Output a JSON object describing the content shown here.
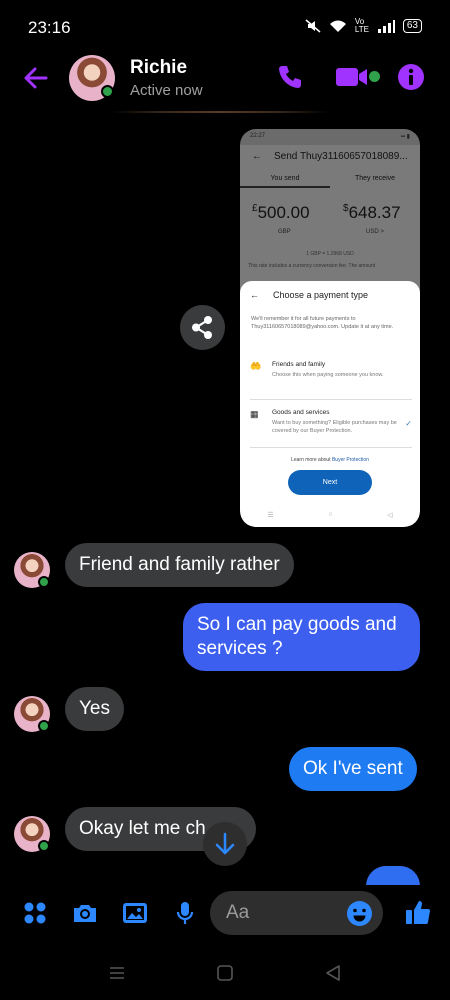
{
  "status": {
    "time": "23:16",
    "network": "Vo LTE",
    "battery": "63",
    "icons": [
      "mute-icon",
      "wifi-icon",
      "volte-icon",
      "signal-icon",
      "battery-icon"
    ]
  },
  "header": {
    "contact_name": "Richie",
    "presence": "Active now",
    "accent": "#a033ff",
    "icons": [
      "back-arrow-icon",
      "phone-icon",
      "video-camera-icon",
      "info-icon"
    ]
  },
  "shared_image": {
    "status_time": "22:27",
    "title": "Send Thuy31160657018089...",
    "tab_send": "You send",
    "tab_receive": "They receive",
    "send_amount": "500.00",
    "send_symbol": "£",
    "send_currency": "GBP",
    "receive_amount": "648.37",
    "receive_symbol": "$",
    "receive_currency": "USD >",
    "rate": "1 GBP = 1.2968 USD",
    "note": "This rate includes a currency conversion fee. The amount",
    "sheet_title": "Choose a payment type",
    "sheet_text": "We'll remember it for all future payments to Thuy31160657018089@yahoo.com. Update it at any time.",
    "option1_title": "Friends and family",
    "option1_desc": "Choose this when paying someone you know.",
    "option2_title": "Goods and services",
    "option2_desc": "Want to buy something? Eligible purchases may be covered by our Buyer Protection.",
    "learn_more": "Learn more about",
    "learn_link": "Buyer Protection",
    "next_button": "Next"
  },
  "messages": [
    {
      "from": "them",
      "text": "Friend and family rather"
    },
    {
      "from": "me",
      "text": "So I can pay goods and services ?"
    },
    {
      "from": "them",
      "text": "Yes"
    },
    {
      "from": "me",
      "text": "Ok I've sent"
    },
    {
      "from": "them",
      "text": "Okay let me ch..."
    }
  ],
  "message_colors": {
    "incoming": "#3a3b3c",
    "outgoing_top": "#3d5ff0",
    "outgoing_bottom": "#1f7bf2"
  },
  "composer": {
    "placeholder": "Aa",
    "accent": "#2d88ff",
    "icons": [
      "menu-dots-icon",
      "camera-icon",
      "gallery-icon",
      "microphone-icon",
      "emoji-icon",
      "thumbs-up-icon"
    ]
  }
}
